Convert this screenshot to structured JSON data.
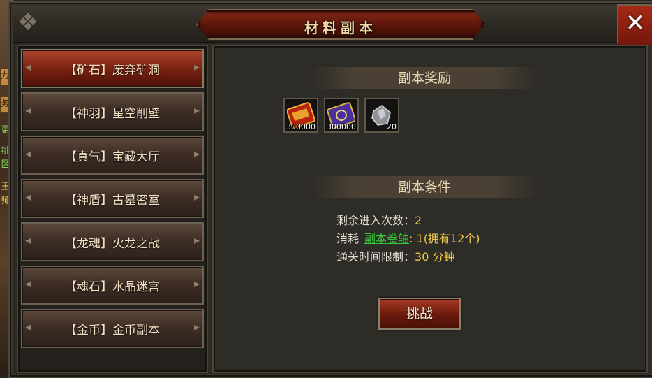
{
  "window": {
    "title": "材料副本",
    "close_label": "✕"
  },
  "backdrop": {
    "tags": [
      "力",
      "务",
      "更",
      "挑",
      "区",
      "王",
      "师"
    ]
  },
  "dungeons": [
    {
      "label": "【矿石】废弃矿洞",
      "active": true
    },
    {
      "label": "【神羽】星空削壁",
      "active": false
    },
    {
      "label": "【真气】宝藏大厅",
      "active": false
    },
    {
      "label": "【神盾】古墓密室",
      "active": false
    },
    {
      "label": "【龙魂】火龙之战",
      "active": false
    },
    {
      "label": "【魂石】水晶迷宫",
      "active": false
    },
    {
      "label": "【金币】金币副本",
      "active": false
    }
  ],
  "rewards_section": {
    "title": "副本奖励",
    "items": [
      {
        "icon": "exp-scroll-icon",
        "count": "300000"
      },
      {
        "icon": "purple-scroll-icon",
        "count": "300000"
      },
      {
        "icon": "ore-crystal-icon",
        "count": "20"
      }
    ]
  },
  "conditions_section": {
    "title": "副本条件",
    "remaining_label": "剩余进入次数：",
    "remaining_value": "2",
    "cost_label": "消耗",
    "cost_item": "副本卷轴",
    "cost_value": ": 1(拥有12个)",
    "time_label": "通关时间限制：",
    "time_value": "30 分钟"
  },
  "challenge_button": "挑战",
  "colors": {
    "accent_red": "#7a2212",
    "value_yellow": "#f1c84a",
    "link_green": "#38c838"
  }
}
